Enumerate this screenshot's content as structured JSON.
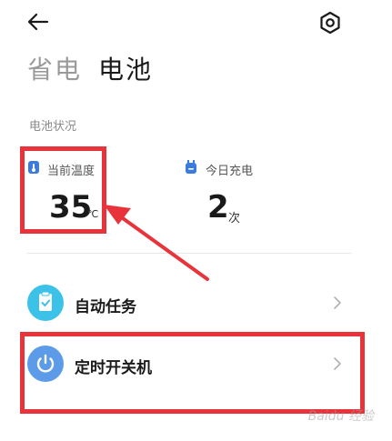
{
  "header": {
    "tab_power_saving": "省电",
    "tab_battery": "电池"
  },
  "battery_status": {
    "section_title": "电池状况",
    "temperature": {
      "label": "当前温度",
      "value": "35",
      "unit": "℃"
    },
    "charges_today": {
      "label": "今日充电",
      "value": "2",
      "unit": "次"
    }
  },
  "menu": {
    "items": [
      {
        "label": "自动任务",
        "icon": "clipboard-check-icon",
        "color": "#3cc1e8"
      },
      {
        "label": "定时开关机",
        "icon": "power-icon",
        "color": "#5b9be8"
      }
    ]
  },
  "colors": {
    "annotation": "#e8333b",
    "accent_blue": "#3b7be0"
  },
  "watermark": "Baidu 经验"
}
